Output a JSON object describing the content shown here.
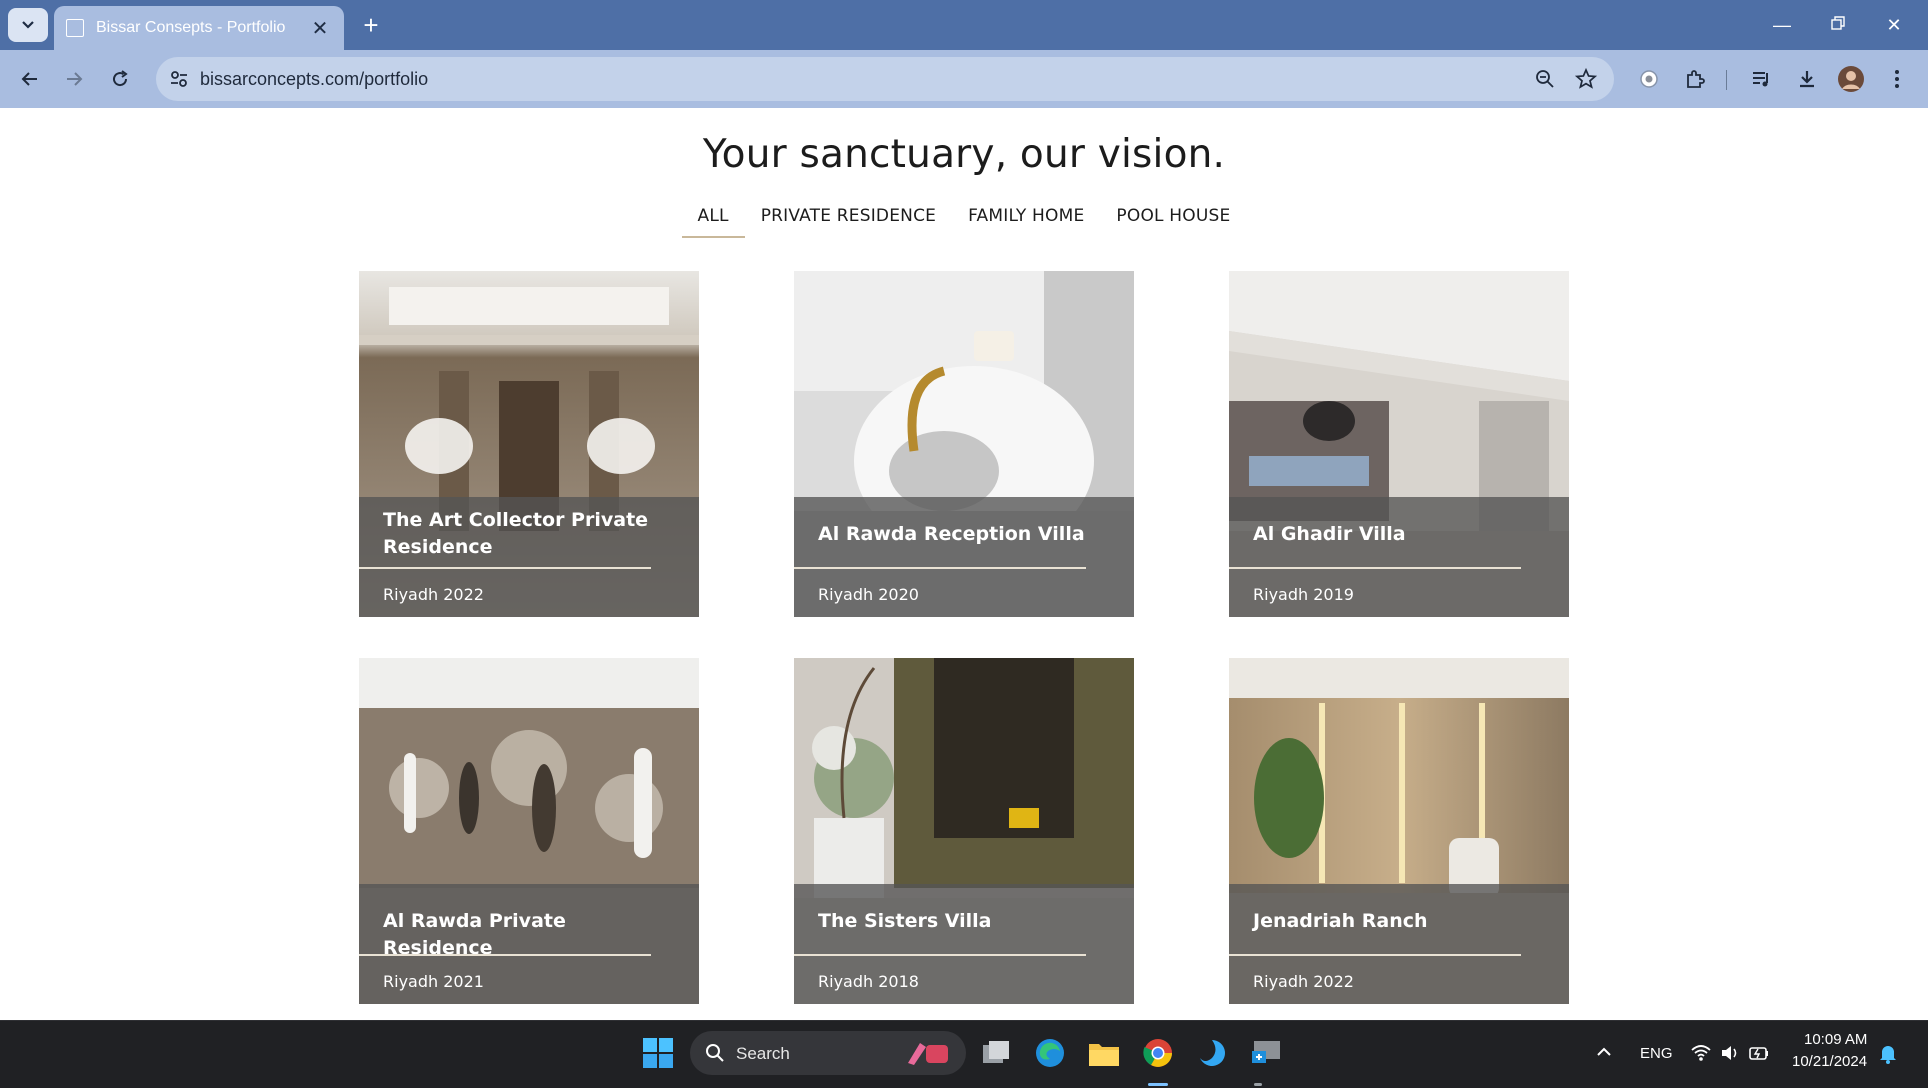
{
  "browser": {
    "tab_title": "Bissar Consepts - Portfolio",
    "url": "bissarconcepts.com/portfolio"
  },
  "page": {
    "headline": "Your sanctuary, our vision.",
    "filters": [
      "ALL",
      "PRIVATE RESIDENCE",
      "FAMILY HOME",
      "POOL HOUSE"
    ],
    "active_filter": "ALL",
    "projects": [
      {
        "name": "The Art Collector Private Residence",
        "meta": "Riyadh 2022"
      },
      {
        "name": "Al Rawda Reception Villa",
        "meta": "Riyadh 2020"
      },
      {
        "name": "Al Ghadir Villa",
        "meta": "Riyadh 2019"
      },
      {
        "name": "Al Rawda Private Residence",
        "meta": "Riyadh 2021"
      },
      {
        "name": "The Sisters Villa",
        "meta": "Riyadh 2018"
      },
      {
        "name": "Jenadriah Ranch",
        "meta": "Riyadh 2022"
      }
    ]
  },
  "taskbar": {
    "search_label": "Search",
    "language": "ENG",
    "time": "10:09 AM",
    "date": "10/21/2024"
  },
  "colors": {
    "titlebar": "#4e6fa6",
    "toolbar": "#a9bde0",
    "filter_underline": "#c9b89a",
    "card_overlay": "#555555"
  }
}
